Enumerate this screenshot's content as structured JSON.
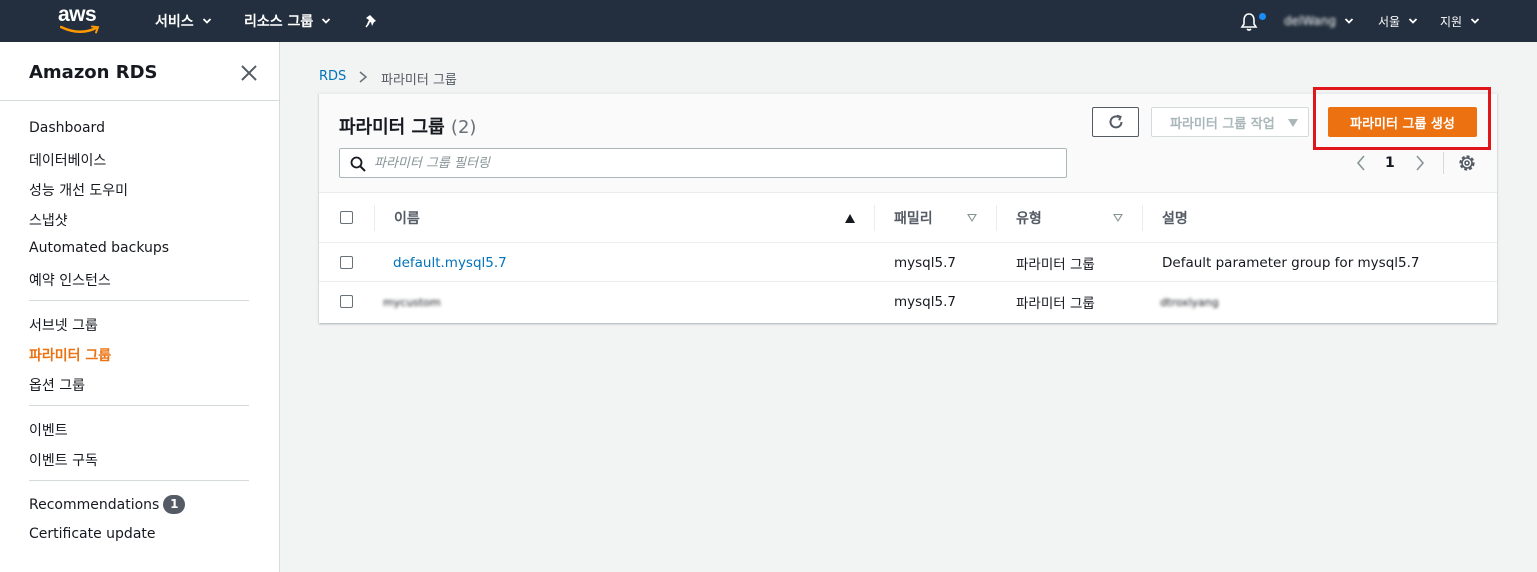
{
  "topnav": {
    "logo": "aws",
    "services": "서비스",
    "resource_groups": "리소스 그룹",
    "user": "delWang",
    "region": "서울",
    "support": "지원"
  },
  "sidebar": {
    "title": "Amazon RDS",
    "group1": [
      "Dashboard",
      "데이터베이스",
      "성능 개선 도우미",
      "스냅샷",
      "Automated backups",
      "예약 인스턴스"
    ],
    "group2": [
      "서브넷 그룹",
      "파라미터 그룹",
      "옵션 그룹"
    ],
    "group3": [
      "이벤트",
      "이벤트 구독"
    ],
    "recommendations": "Recommendations",
    "recommendations_badge": "1",
    "certificate_update": "Certificate update",
    "active_item": "파라미터 그룹"
  },
  "breadcrumb": {
    "root": "RDS",
    "current": "파라미터 그룹"
  },
  "panel": {
    "title": "파라미터 그룹",
    "count": "(2)",
    "actions_label": "파라미터 그룹 작업",
    "create_label": "파라미터 그룹 생성",
    "search_placeholder": "파라미터 그룹 필터링",
    "page": "1"
  },
  "table": {
    "columns": [
      "이름",
      "패밀리",
      "유형",
      "설명"
    ],
    "rows": [
      {
        "name": "default.mysql5.7",
        "family": "mysql5.7",
        "type": "파라미터 그룹",
        "description": "Default parameter group for mysql5.7"
      },
      {
        "name": "mycustom",
        "family": "mysql5.7",
        "type": "파라미터 그룹",
        "description": "dtroxlyang"
      }
    ]
  },
  "colors": {
    "nav_bg": "#232f3e",
    "accent": "#ec7211",
    "link": "#0073bb",
    "highlight": "#e0161b"
  }
}
